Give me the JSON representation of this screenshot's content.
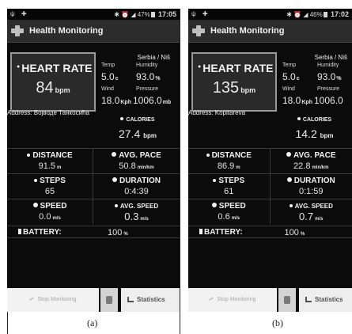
{
  "app_title": "Health Monitoring",
  "panels": [
    {
      "status": {
        "clock": "17:05",
        "battery_percent": "47%"
      },
      "heart_rate": {
        "label": "HEART RATE",
        "value": "84",
        "unit": "bpm"
      },
      "weather": {
        "city": "Serbia / Niš",
        "temp_label": "Temp",
        "temp_value": "5.0",
        "temp_unit": "c",
        "humidity_label": "Humidity",
        "humidity_value": "93.0",
        "humidity_unit": "%",
        "wind_label": "Wind",
        "wind_value": "18.0",
        "wind_unit": "Kph",
        "pressure_label": "Pressure",
        "pressure_value": "1006.0",
        "pressure_unit": "mb"
      },
      "address": "Address: Војводе Танкосића",
      "calories": {
        "label": "CALORIES",
        "value": "27.4",
        "unit": "bpm"
      },
      "distance": {
        "label": "DISTANCE",
        "value": "91.5",
        "unit": "m"
      },
      "avg_pace": {
        "label": "AVG. PACE",
        "value": "50.8",
        "unit": "min/km"
      },
      "steps": {
        "label": "STEPS",
        "value": "65"
      },
      "duration": {
        "label": "DURATION",
        "value": "0:4:39"
      },
      "speed": {
        "label": "SPEED",
        "value": "0.0",
        "unit": "m/s"
      },
      "avg_speed": {
        "label": "AVG. SPEED",
        "value": "0.3",
        "unit": "m/s"
      },
      "battery": {
        "label": "BATTERY:",
        "value": "100",
        "unit": "%"
      },
      "buttons": {
        "stop": "Stop Monitoring",
        "statistics": "Statistics"
      },
      "caption": "(a)"
    },
    {
      "status": {
        "clock": "17:02",
        "battery_percent": "46%"
      },
      "heart_rate": {
        "label": "HEART RATE",
        "value": "135",
        "unit": "bpm"
      },
      "weather": {
        "city": "Serbia / Niš",
        "temp_label": "Temp",
        "temp_value": "5.0",
        "temp_unit": "c",
        "humidity_label": "Humidity",
        "humidity_value": "93.0",
        "humidity_unit": "%",
        "wind_label": "Wind",
        "wind_value": "18.0",
        "wind_unit": "Kph",
        "pressure_label": "Pressure",
        "pressure_value": "1006.0",
        "pressure_unit": ""
      },
      "address": "Address: Kopitareva",
      "calories": {
        "label": "CALORIES",
        "value": "14.2",
        "unit": "bpm"
      },
      "distance": {
        "label": "DISTANCE",
        "value": "86.9",
        "unit": "m"
      },
      "avg_pace": {
        "label": "AVG. PACE",
        "value": "22.8",
        "unit": "min/km"
      },
      "steps": {
        "label": "STEPS",
        "value": "61"
      },
      "duration": {
        "label": "DURATION",
        "value": "0:1:59"
      },
      "speed": {
        "label": "SPEED",
        "value": "0.6",
        "unit": "m/s"
      },
      "avg_speed": {
        "label": "AVG. SPEED",
        "value": "0.7",
        "unit": "m/s"
      },
      "battery": {
        "label": "BATTERY:",
        "value": "100",
        "unit": "%"
      },
      "buttons": {
        "stop": "Stop Monitoring",
        "statistics": "Statistics"
      },
      "caption": "(b)"
    }
  ]
}
